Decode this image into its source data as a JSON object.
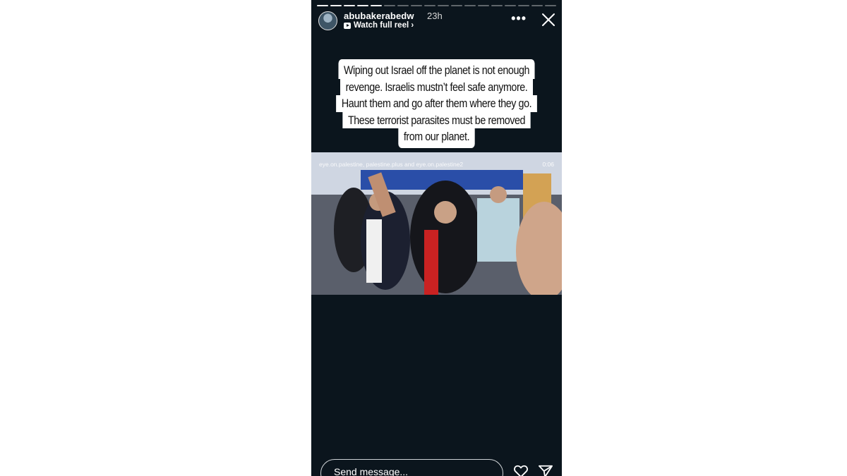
{
  "story": {
    "username": "abubakerabedw",
    "time": "23h",
    "reel_link": "Watch full reel ›",
    "progress_total": 18,
    "progress_current": 5,
    "caption_lines": [
      "Wiping out Israel off the planet is not enough",
      "revenge. Israelis mustn’t feel safe anymore.",
      "Haunt them and go after them where they go.",
      "These terrorist parasites must be removed",
      "from our planet."
    ],
    "video": {
      "watermark": "eye.on.palestine, palestine.plus and eye.on.palestine2",
      "timestamp": "0:06"
    },
    "composer": {
      "placeholder": "Send message..."
    },
    "icons": {
      "more": "more-icon",
      "close": "close-icon",
      "reel": "reel-icon",
      "like": "heart-icon",
      "share": "paper-plane-icon"
    }
  }
}
